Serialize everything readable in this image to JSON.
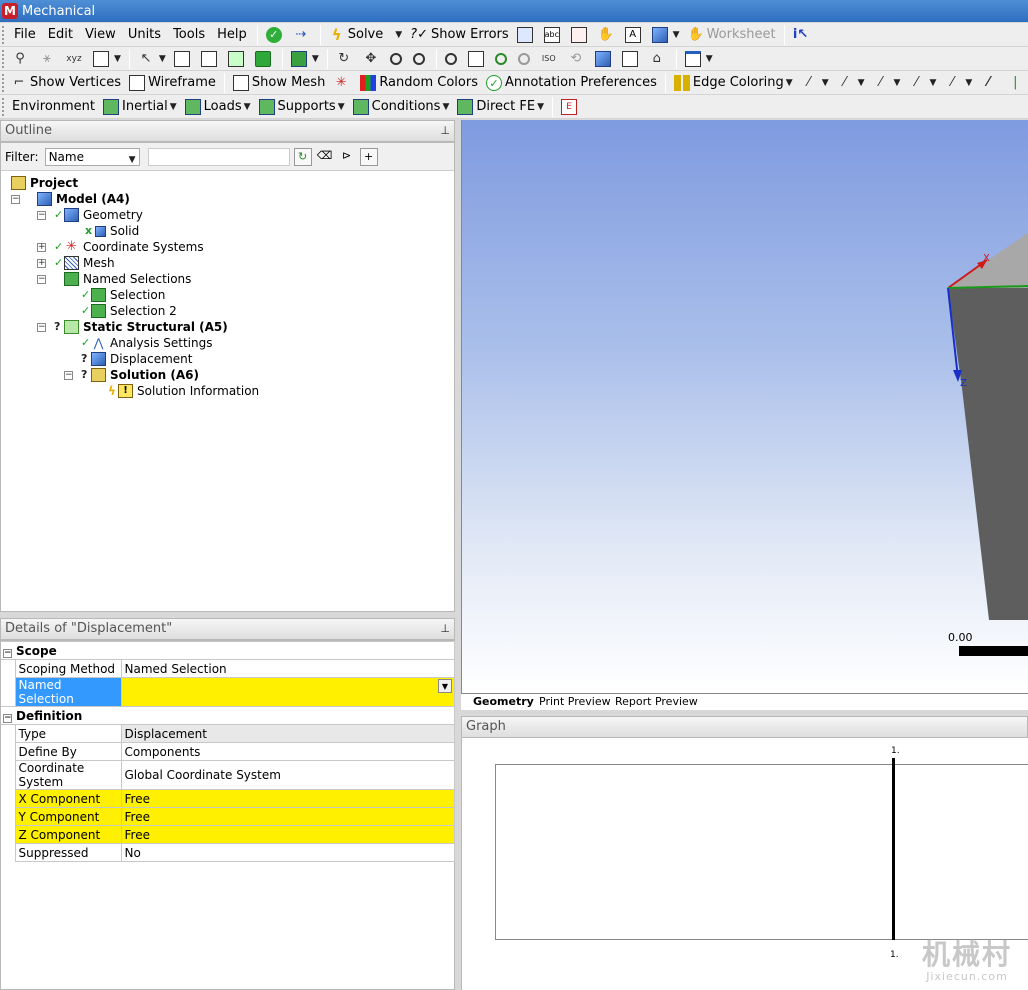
{
  "window": {
    "title": "Mechanical"
  },
  "menu": {
    "items": [
      "File",
      "Edit",
      "View",
      "Units",
      "Tools",
      "Help"
    ]
  },
  "toolbar1": {
    "solve": "Solve",
    "show_errors": "Show Errors",
    "worksheet": "Worksheet"
  },
  "toolbar3": {
    "show_vertices": "Show Vertices",
    "wireframe": "Wireframe",
    "show_mesh": "Show Mesh",
    "random_colors": "Random Colors",
    "annotation_preferences": "Annotation Preferences",
    "edge_coloring": "Edge Coloring"
  },
  "toolbar4": {
    "environment": "Environment",
    "inertial": "Inertial",
    "loads": "Loads",
    "supports": "Supports",
    "conditions": "Conditions",
    "direct_fe": "Direct FE"
  },
  "outline": {
    "header": "Outline",
    "filter_label": "Filter:",
    "filter_value": "Name",
    "tree": {
      "project": "Project",
      "model": "Model (A4)",
      "geometry": "Geometry",
      "solid": "Solid",
      "coordinate_systems": "Coordinate Systems",
      "mesh": "Mesh",
      "named_selections": "Named Selections",
      "selection": "Selection",
      "selection2": "Selection 2",
      "static_structural": "Static Structural (A5)",
      "analysis_settings": "Analysis Settings",
      "displacement": "Displacement",
      "solution": "Solution (A6)",
      "solution_information": "Solution Information"
    }
  },
  "details": {
    "header": "Details of \"Displacement\"",
    "scope": {
      "category": "Scope",
      "rows": [
        {
          "key": "Scoping Method",
          "value": "Named Selection"
        },
        {
          "key": "Named Selection",
          "value": ""
        }
      ]
    },
    "definition": {
      "category": "Definition",
      "rows": [
        {
          "key": "Type",
          "value": "Displacement"
        },
        {
          "key": "Define By",
          "value": "Components"
        },
        {
          "key": "Coordinate System",
          "value": "Global Coordinate System"
        },
        {
          "key": "X Component",
          "value": "Free"
        },
        {
          "key": "Y Component",
          "value": "Free"
        },
        {
          "key": "Z Component",
          "value": "Free"
        },
        {
          "key": "Suppressed",
          "value": "No"
        }
      ]
    }
  },
  "viewport": {
    "scale_label": "0.00",
    "axis_x": "X",
    "axis_z": "Z",
    "tabs": [
      "Geometry",
      "Print Preview",
      "Report Preview"
    ]
  },
  "graph": {
    "header": "Graph",
    "tick_top": "1.",
    "tick_bottom": "1."
  },
  "watermark": {
    "line1": "机械村",
    "line2": "Jixiecun.com"
  },
  "colors": {
    "highlight_yellow": "#fff000",
    "selection_blue": "#3399ff",
    "titlebar": "#2e6dbf"
  }
}
